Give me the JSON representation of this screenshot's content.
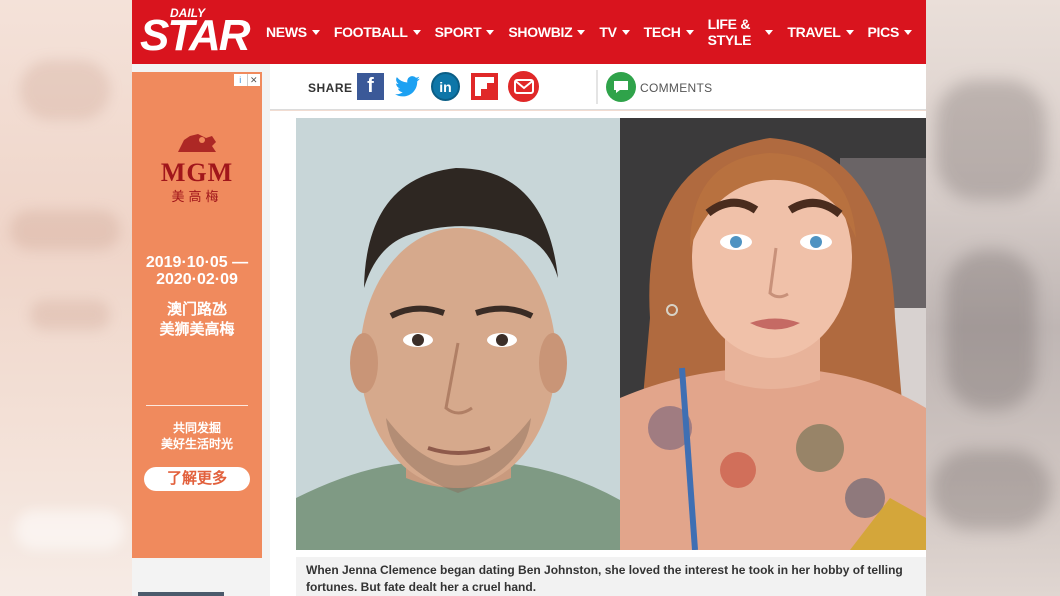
{
  "site": {
    "logo_top": "DAILY",
    "logo_main": "STAR",
    "brand_color": "#d9141e"
  },
  "nav": {
    "items": [
      {
        "label": "NEWS"
      },
      {
        "label": "FOOTBALL"
      },
      {
        "label": "SPORT"
      },
      {
        "label": "SHOWBIZ"
      },
      {
        "label": "TV"
      },
      {
        "label": "TECH"
      },
      {
        "label": "LIFE & STYLE"
      },
      {
        "label": "TRAVEL"
      },
      {
        "label": "PICS"
      }
    ]
  },
  "share": {
    "label": "SHARE",
    "icons": [
      "facebook-icon",
      "twitter-icon",
      "linkedin-icon",
      "flipboard-icon",
      "email-icon"
    ],
    "linkedin_text": "in",
    "facebook_text": "f",
    "comments_label": "COMMENTS"
  },
  "ad": {
    "badge_info": "i",
    "badge_close": "✕",
    "brand": "MGM",
    "brand_cn": "美高梅",
    "date_line1": "2019·10·05 —",
    "date_line2": "2020·02·09",
    "location_line1": "澳门路氹",
    "location_line2": "美狮美高梅",
    "tagline1": "共同发掘",
    "tagline2": "美好生活时光",
    "button": "了解更多",
    "bg_color": "#f08a5d"
  },
  "article": {
    "caption": "When Jenna Clemence began dating Ben Johnston, she loved the interest he took in her hobby of telling fortunes. But fate dealt her a cruel hand."
  }
}
